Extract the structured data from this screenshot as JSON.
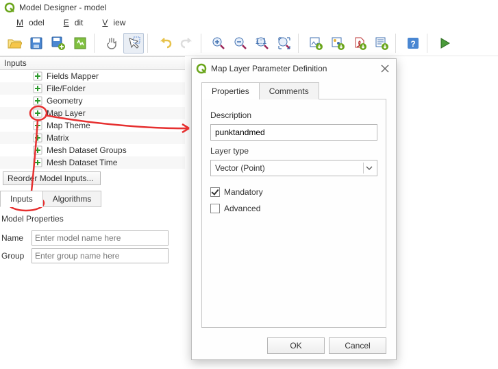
{
  "window": {
    "app_title": "Model Designer - model"
  },
  "menubar": {
    "model": "Model",
    "edit": "Edit",
    "view": "View"
  },
  "inputs_panel": {
    "header": "Inputs",
    "items": [
      "Fields Mapper",
      "File/Folder",
      "Geometry",
      "Map Layer",
      "Map Theme",
      "Matrix",
      "Mesh Dataset Groups",
      "Mesh Dataset Time"
    ],
    "reorder_label": "Reorder Model Inputs..."
  },
  "left_tabs": {
    "inputs": "Inputs",
    "algorithms": "Algorithms"
  },
  "model_props": {
    "header": "Model Properties",
    "name_label": "Name",
    "name_placeholder": "Enter model name here",
    "group_label": "Group",
    "group_placeholder": "Enter group name here"
  },
  "dialog": {
    "title": "Map Layer Parameter Definition",
    "tabs": {
      "properties": "Properties",
      "comments": "Comments"
    },
    "desc_label": "Description",
    "desc_value": "punktandmed",
    "layertype_label": "Layer type",
    "layertype_value": "Vector (Point)",
    "mandatory_label": "Mandatory",
    "mandatory_checked": true,
    "advanced_label": "Advanced",
    "advanced_checked": false,
    "ok_label": "OK",
    "cancel_label": "Cancel"
  }
}
